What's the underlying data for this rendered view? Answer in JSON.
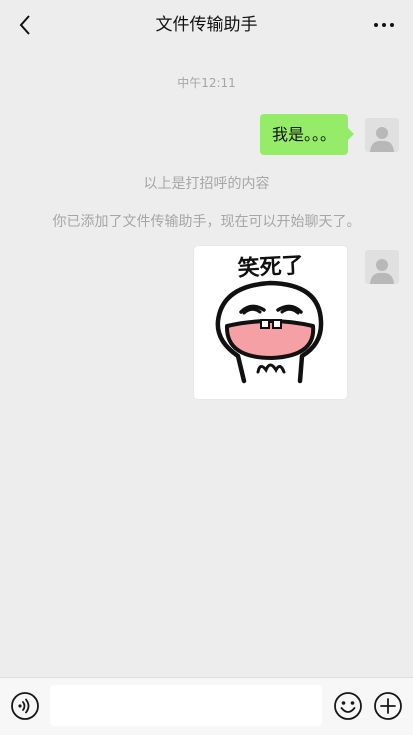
{
  "header": {
    "title": "文件传输助手",
    "back_icon": "chevron-left-icon",
    "more_icon": "ellipsis-icon"
  },
  "messages": {
    "timestamp": "中午12:11",
    "text_message": "我是。。。",
    "system_1": "以上是打招呼的内容",
    "system_2": "你已添加了文件传输助手，现在可以开始聊天了。",
    "sticker_caption": "笑死了"
  },
  "input_bar": {
    "input_value": "",
    "voice_icon": "voice-icon",
    "emoji_icon": "emoji-icon",
    "plus_icon": "plus-icon"
  },
  "colors": {
    "background": "#ededed",
    "bubble_green": "#95ec69",
    "system_text": "#a6a6a6",
    "sticker_mouth_pink": "#f4a0a4"
  }
}
